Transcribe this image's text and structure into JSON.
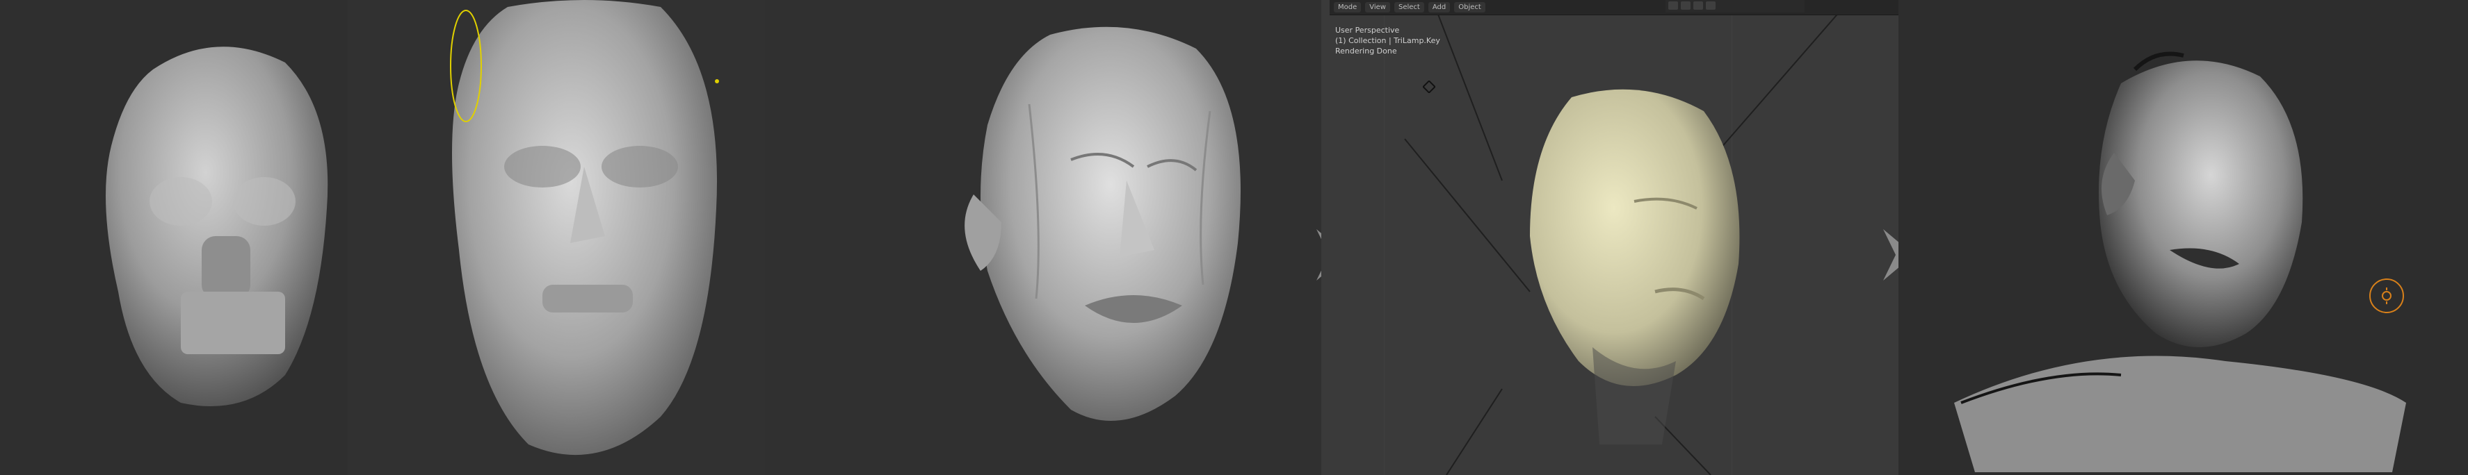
{
  "viewport": {
    "toolbar": {
      "mode": "Mode",
      "view": "View",
      "select": "Select",
      "add": "Add",
      "object": "Object"
    },
    "info": {
      "perspective": "User Perspective",
      "collection": "(1) Collection | TriLamp.Key",
      "status": "Rendering Done"
    }
  },
  "colors": {
    "background": "#303030",
    "arrow": "#8a8a8a",
    "clay": "#a9a9a9",
    "render_clay": "#c7c3a0",
    "yellow_marker": "#e0d000",
    "orange_cursor": "#d8801a"
  },
  "icons": [
    "arrow-right-icon",
    "light-icon",
    "brush-cursor-icon"
  ]
}
